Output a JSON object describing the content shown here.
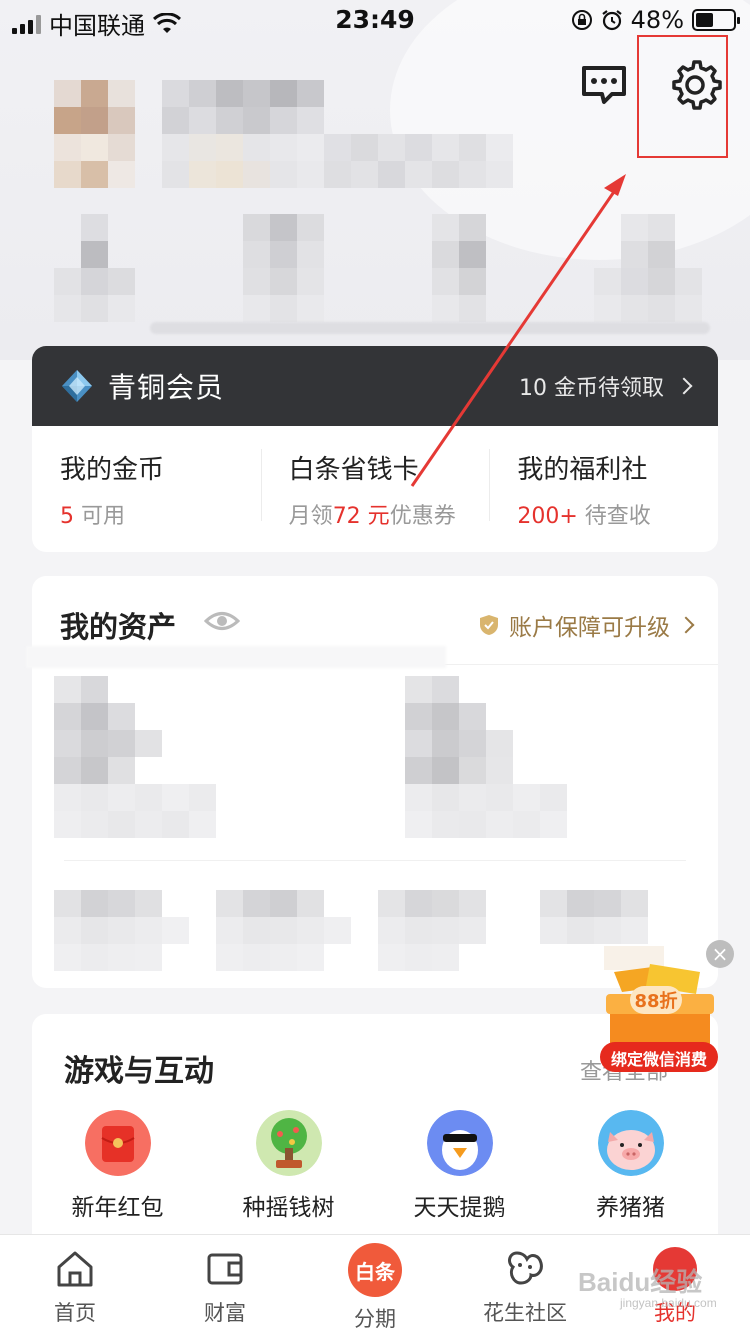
{
  "status_bar": {
    "carrier": "中国联通",
    "time": "23:49",
    "battery": "48%",
    "battery_level": 0.48
  },
  "header": {
    "message_icon": "message-dots-icon",
    "settings_icon": "gear-icon"
  },
  "member": {
    "level": "青铜会员",
    "coins_pending": "10 金币待领取",
    "cols": [
      {
        "title": "我的金币",
        "value": "5",
        "suffix": "可用"
      },
      {
        "title": "白条省钱卡",
        "prefix": "月领",
        "value": "72 元",
        "suffix": "优惠券"
      },
      {
        "title": "我的福利社",
        "value": "200+",
        "suffix": "待查收"
      }
    ]
  },
  "assets": {
    "title": "我的资产",
    "security": "账户保障可升级"
  },
  "games": {
    "title": "游戏与互动",
    "more": "查看全部",
    "items": [
      {
        "label": "新年红包",
        "icon": "red-envelope-icon"
      },
      {
        "label": "种摇钱树",
        "icon": "money-tree-icon"
      },
      {
        "label": "天天提鹅",
        "icon": "goose-icon"
      },
      {
        "label": "养猪猪",
        "icon": "pig-icon"
      }
    ]
  },
  "promo": {
    "discount": "88折",
    "text": "绑定微信消费"
  },
  "tabbar": {
    "items": [
      {
        "label": "首页",
        "icon": "home-icon"
      },
      {
        "label": "财富",
        "icon": "wallet-icon"
      },
      {
        "label": "分期",
        "badge": "白条",
        "icon": "baitiao-icon"
      },
      {
        "label": "花生社区",
        "icon": "peanut-icon"
      },
      {
        "label": "我的",
        "icon": "profile-icon"
      }
    ]
  },
  "watermark": {
    "brand": "Baidu经验",
    "url": "jingyan.baidu.com"
  },
  "colors": {
    "accent_red": "#e5322d",
    "dark_bar": "#333437",
    "gold": "#9a7a46"
  }
}
